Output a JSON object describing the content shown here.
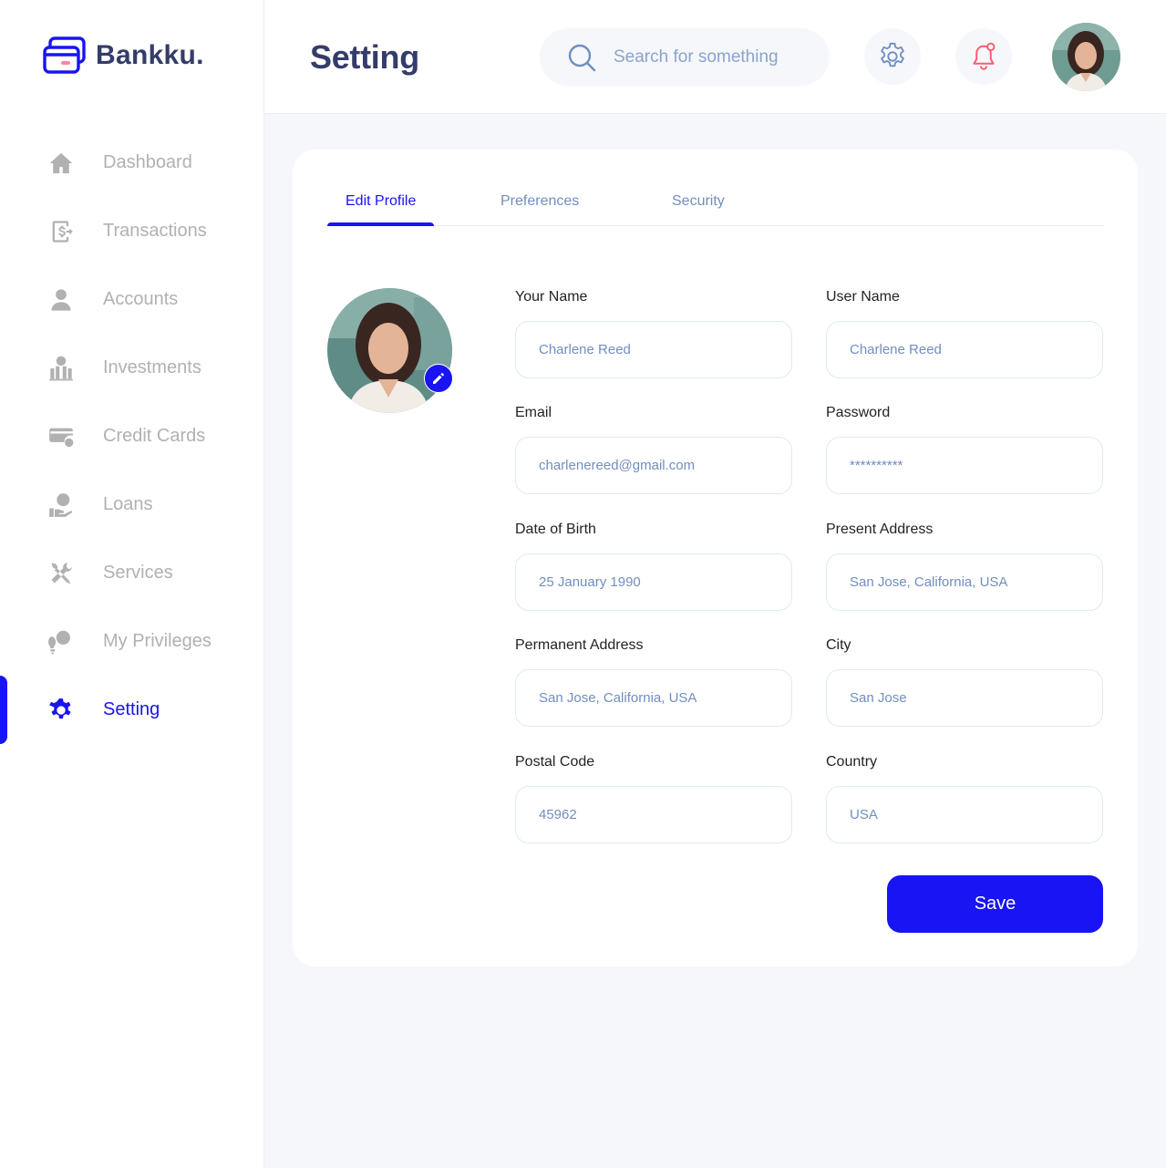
{
  "app": {
    "name": "Bankku."
  },
  "colors": {
    "accent": "#1814f3",
    "title": "#343c6a",
    "muted": "#b1b1b1",
    "field_text": "#718ebf",
    "bell_dot": "#fe5c73"
  },
  "sidebar": {
    "items": [
      {
        "label": "Dashboard",
        "icon": "home-icon",
        "active": false
      },
      {
        "label": "Transactions",
        "icon": "transfer-icon",
        "active": false
      },
      {
        "label": "Accounts",
        "icon": "user-icon",
        "active": false
      },
      {
        "label": "Investments",
        "icon": "investment-icon",
        "active": false
      },
      {
        "label": "Credit Cards",
        "icon": "credit-card-icon",
        "active": false
      },
      {
        "label": "Loans",
        "icon": "loan-icon",
        "active": false
      },
      {
        "label": "Services",
        "icon": "services-icon",
        "active": false
      },
      {
        "label": "My Privileges",
        "icon": "privileges-icon",
        "active": false
      },
      {
        "label": "Setting",
        "icon": "gear-icon",
        "active": true
      }
    ]
  },
  "header": {
    "title": "Setting",
    "search": {
      "placeholder": "Search for something",
      "value": ""
    }
  },
  "tabs": [
    {
      "label": "Edit Profile",
      "active": true
    },
    {
      "label": "Preferences",
      "active": false
    },
    {
      "label": "Security",
      "active": false
    }
  ],
  "form": {
    "your_name": {
      "label": "Your Name",
      "value": "Charlene Reed"
    },
    "user_name": {
      "label": "User Name",
      "value": "Charlene Reed"
    },
    "email": {
      "label": "Email",
      "value": "charlenereed@gmail.com"
    },
    "password": {
      "label": "Password",
      "value": "**********"
    },
    "dob": {
      "label": "Date of Birth",
      "value": "25 January 1990"
    },
    "present_address": {
      "label": "Present Address",
      "value": "San Jose, California, USA"
    },
    "permanent_address": {
      "label": "Permanent Address",
      "value": "San Jose, California, USA"
    },
    "city": {
      "label": "City",
      "value": "San Jose"
    },
    "postal_code": {
      "label": "Postal Code",
      "value": "45962"
    },
    "country": {
      "label": "Country",
      "value": "USA"
    },
    "save_label": "Save"
  }
}
